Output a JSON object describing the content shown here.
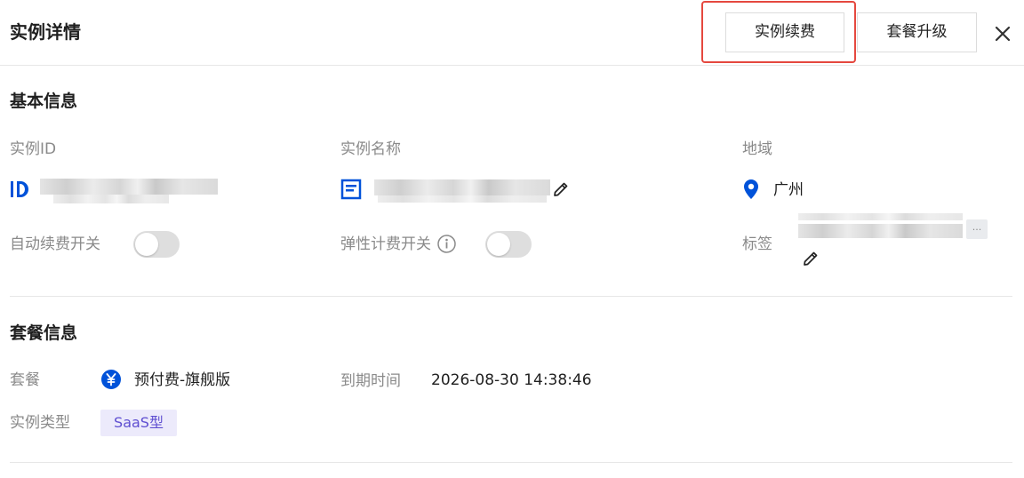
{
  "header": {
    "title": "实例详情",
    "renew_button": "实例续费",
    "upgrade_button": "套餐升级",
    "close_icon": "close-icon"
  },
  "basic_info": {
    "title": "基本信息",
    "instance_id_label": "实例ID",
    "instance_name_label": "实例名称",
    "region_label": "地域",
    "region_value": "广州",
    "auto_renew_label": "自动续费开关",
    "elastic_billing_label": "弹性计费开关",
    "tags_label": "标签",
    "more_tags": "...",
    "auto_renew_on": false,
    "elastic_billing_on": false
  },
  "package_info": {
    "title": "套餐信息",
    "package_label": "套餐",
    "package_value": "预付费-旗舰版",
    "expire_label": "到期时间",
    "expire_value": "2026-08-30 14:38:46",
    "instance_type_label": "实例类型",
    "instance_type_value": "SaaS型"
  },
  "colors": {
    "accent": "#0052d9",
    "highlight_border": "#e5483f",
    "badge_bg": "#eceafb",
    "badge_text": "#5f4fd1"
  }
}
